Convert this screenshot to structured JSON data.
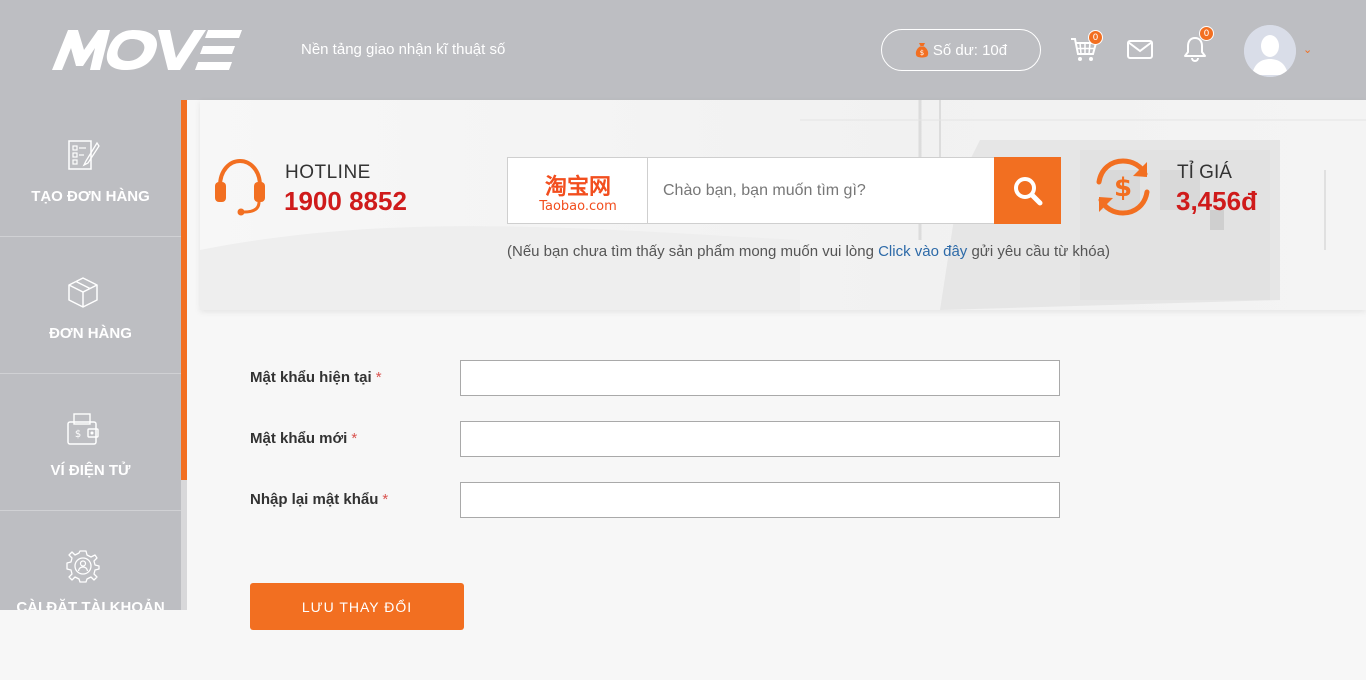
{
  "header": {
    "logo_text": "MOVE",
    "tagline": "Nền tảng giao nhận kĩ thuật số",
    "balance_label": "Số dư: 10đ",
    "cart_count": "0",
    "notification_count": "0",
    "icons": [
      "money-bag-icon",
      "cart-icon",
      "mail-icon",
      "bell-icon",
      "avatar",
      "chevron-down-icon"
    ]
  },
  "sidebar": {
    "items": [
      {
        "label": "TẠO ĐƠN HÀNG",
        "icon": "edit-document-icon"
      },
      {
        "label": "ĐƠN HÀNG",
        "icon": "box-icon"
      },
      {
        "label": "VÍ ĐIỆN TỬ",
        "icon": "wallet-icon"
      },
      {
        "label": "CÀI ĐẶT TÀI KHOẢN",
        "icon": "gear-user-icon"
      }
    ]
  },
  "banner": {
    "hotline_label": "HOTLINE",
    "hotline_number": "1900 8852",
    "taobao_cn": "淘宝网",
    "taobao_en": "Taobao.com",
    "search_placeholder": "Chào bạn, bạn muốn tìm gì?",
    "hint_before": "(Nếu bạn chưa tìm thấy sản phẩm mong muốn vui lòng ",
    "hint_link": "Click vào đây",
    "hint_after": " gửi yêu cầu từ khóa)",
    "rate_label": "TỈ GIÁ",
    "rate_value": "3,456đ"
  },
  "form": {
    "fields": [
      {
        "label": "Mật khẩu hiện tại",
        "required_mark": "*",
        "value": ""
      },
      {
        "label": "Mật khẩu mới",
        "required_mark": "*",
        "value": ""
      },
      {
        "label": "Nhập lại mật khẩu",
        "required_mark": "*",
        "value": ""
      }
    ],
    "save_label": "LƯU THAY ĐỔI"
  },
  "colors": {
    "accent": "#f26f21",
    "header_bg": "#bdbec2",
    "price_red": "#cf1b1b",
    "link_blue": "#2d6aa8"
  }
}
